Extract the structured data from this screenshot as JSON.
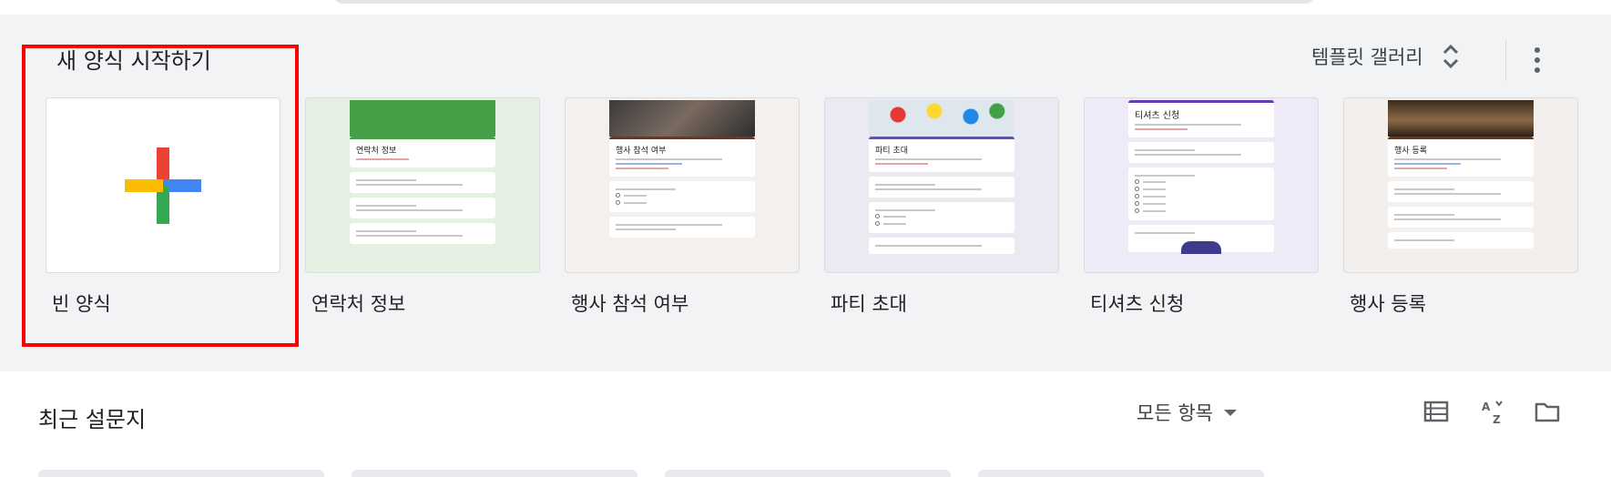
{
  "start_section": {
    "title": "새 양식 시작하기",
    "gallery_label": "템플릿 갤러리"
  },
  "templates": [
    {
      "name": "빈 양식"
    },
    {
      "name": "연락처 정보",
      "form_title": "연락처 정보",
      "accent": "#43a047"
    },
    {
      "name": "행사 참석 여부",
      "form_title": "행사 참석 여부",
      "accent": "#5f3b2d"
    },
    {
      "name": "파티 초대",
      "form_title": "파티 초대",
      "accent": "#5c55a3"
    },
    {
      "name": "티셔츠 신청",
      "form_title": "티셔츠 신청",
      "accent": "#673ab7"
    },
    {
      "name": "행사 등록",
      "form_title": "행사 등록",
      "accent": "#5d3a2a"
    }
  ],
  "recent_section": {
    "title": "최근 설문지",
    "owner_filter": "모든 항목"
  },
  "colors": {
    "section_bg": "#f1f3f4",
    "highlight": "#ff0000"
  }
}
